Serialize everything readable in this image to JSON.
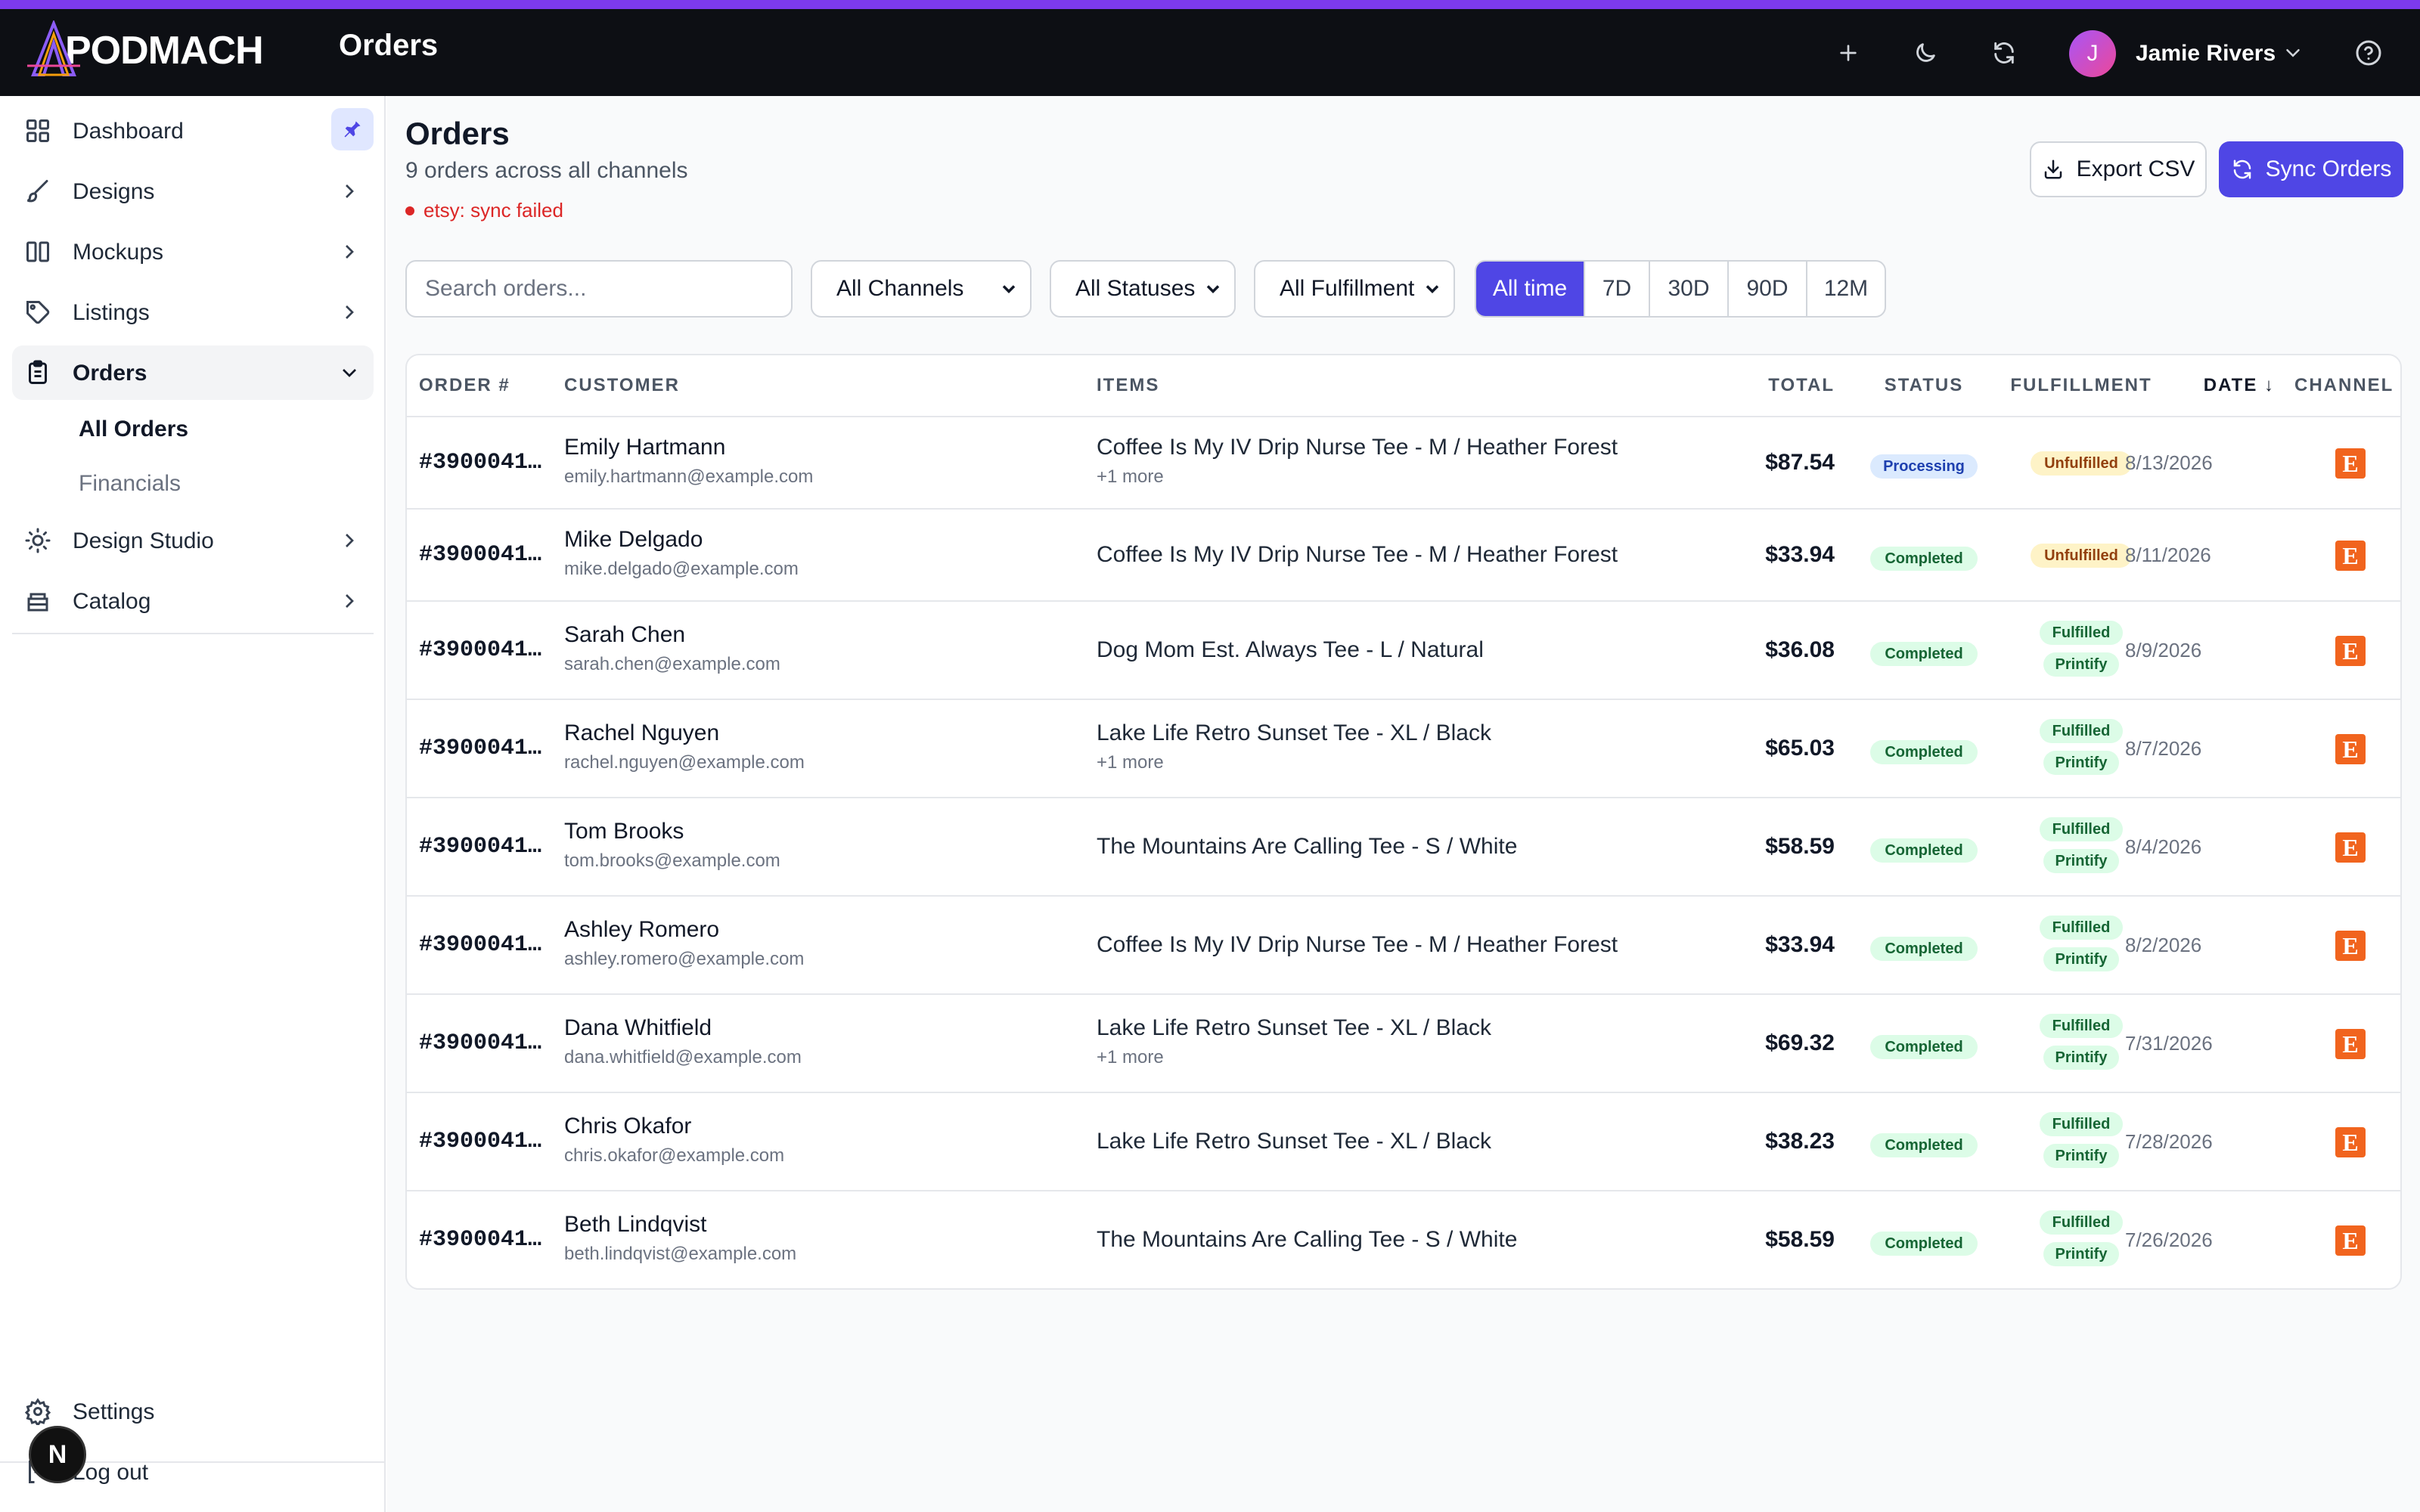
{
  "app": {
    "brand": "PODMACH",
    "page_title": "Orders"
  },
  "topbar": {
    "user_name": "Jamie Rivers",
    "user_initial": "J"
  },
  "sidebar": {
    "items": [
      {
        "label": "Dashboard",
        "icon": "dashboard-icon"
      },
      {
        "label": "Designs",
        "icon": "brush-icon"
      },
      {
        "label": "Mockups",
        "icon": "columns-icon"
      },
      {
        "label": "Listings",
        "icon": "tag-icon"
      },
      {
        "label": "Orders",
        "icon": "clipboard-icon"
      },
      {
        "label": "Design Studio",
        "icon": "lightbulb-icon"
      },
      {
        "label": "Catalog",
        "icon": "storage-icon"
      }
    ],
    "orders_sub": [
      "All Orders",
      "Financials"
    ],
    "settings": "Settings",
    "logout": "Log out",
    "badge": "N"
  },
  "header": {
    "title": "Orders",
    "subtitle": "9 orders across all channels",
    "error": "etsy: sync failed",
    "export_label": "Export CSV",
    "sync_label": "Sync Orders"
  },
  "filters": {
    "search_placeholder": "Search orders...",
    "channel": "All Channels",
    "status": "All Statuses",
    "fulfillment": "All Fulfillment",
    "ranges": [
      "All time",
      "7D",
      "30D",
      "90D",
      "12M"
    ],
    "active_range": "All time"
  },
  "table": {
    "columns": [
      "ORDER #",
      "CUSTOMER",
      "ITEMS",
      "TOTAL",
      "STATUS",
      "FULFILLMENT",
      "DATE ↓",
      "CHANNEL"
    ],
    "rows": [
      {
        "order": "#3900041…",
        "name": "Emily Hartmann",
        "email": "emily.hartmann@example.com",
        "item": "Coffee Is My IV Drip Nurse Tee - M / Heather Forest",
        "more": "+1 more",
        "total": "$87.54",
        "status": "Processing",
        "fulfillment": "Unfulfilled",
        "provider": "",
        "date": "8/13/2026",
        "channel": "E"
      },
      {
        "order": "#3900041…",
        "name": "Mike Delgado",
        "email": "mike.delgado@example.com",
        "item": "Coffee Is My IV Drip Nurse Tee - M / Heather Forest",
        "more": "",
        "total": "$33.94",
        "status": "Completed",
        "fulfillment": "Unfulfilled",
        "provider": "",
        "date": "8/11/2026",
        "channel": "E"
      },
      {
        "order": "#3900041…",
        "name": "Sarah Chen",
        "email": "sarah.chen@example.com",
        "item": "Dog Mom Est. Always Tee - L / Natural",
        "more": "",
        "total": "$36.08",
        "status": "Completed",
        "fulfillment": "Fulfilled",
        "provider": "Printify",
        "date": "8/9/2026",
        "channel": "E"
      },
      {
        "order": "#3900041…",
        "name": "Rachel Nguyen",
        "email": "rachel.nguyen@example.com",
        "item": "Lake Life Retro Sunset Tee - XL / Black",
        "more": "+1 more",
        "total": "$65.03",
        "status": "Completed",
        "fulfillment": "Fulfilled",
        "provider": "Printify",
        "date": "8/7/2026",
        "channel": "E"
      },
      {
        "order": "#3900041…",
        "name": "Tom Brooks",
        "email": "tom.brooks@example.com",
        "item": "The Mountains Are Calling Tee - S / White",
        "more": "",
        "total": "$58.59",
        "status": "Completed",
        "fulfillment": "Fulfilled",
        "provider": "Printify",
        "date": "8/4/2026",
        "channel": "E"
      },
      {
        "order": "#3900041…",
        "name": "Ashley Romero",
        "email": "ashley.romero@example.com",
        "item": "Coffee Is My IV Drip Nurse Tee - M / Heather Forest",
        "more": "",
        "total": "$33.94",
        "status": "Completed",
        "fulfillment": "Fulfilled",
        "provider": "Printify",
        "date": "8/2/2026",
        "channel": "E"
      },
      {
        "order": "#3900041…",
        "name": "Dana Whitfield",
        "email": "dana.whitfield@example.com",
        "item": "Lake Life Retro Sunset Tee - XL / Black",
        "more": "+1 more",
        "total": "$69.32",
        "status": "Completed",
        "fulfillment": "Fulfilled",
        "provider": "Printify",
        "date": "7/31/2026",
        "channel": "E"
      },
      {
        "order": "#3900041…",
        "name": "Chris Okafor",
        "email": "chris.okafor@example.com",
        "item": "Lake Life Retro Sunset Tee - XL / Black",
        "more": "",
        "total": "$38.23",
        "status": "Completed",
        "fulfillment": "Fulfilled",
        "provider": "Printify",
        "date": "7/28/2026",
        "channel": "E"
      },
      {
        "order": "#3900041…",
        "name": "Beth Lindqvist",
        "email": "beth.lindqvist@example.com",
        "item": "The Mountains Are Calling Tee - S / White",
        "more": "",
        "total": "$58.59",
        "status": "Completed",
        "fulfillment": "Fulfilled",
        "provider": "Printify",
        "date": "7/26/2026",
        "channel": "E"
      }
    ]
  },
  "colors": {
    "accent": "#4f46e5",
    "topbar": "#0d0f14",
    "stripe": "#7c3aed",
    "etsy": "#f1641e",
    "error": "#dc2626"
  }
}
